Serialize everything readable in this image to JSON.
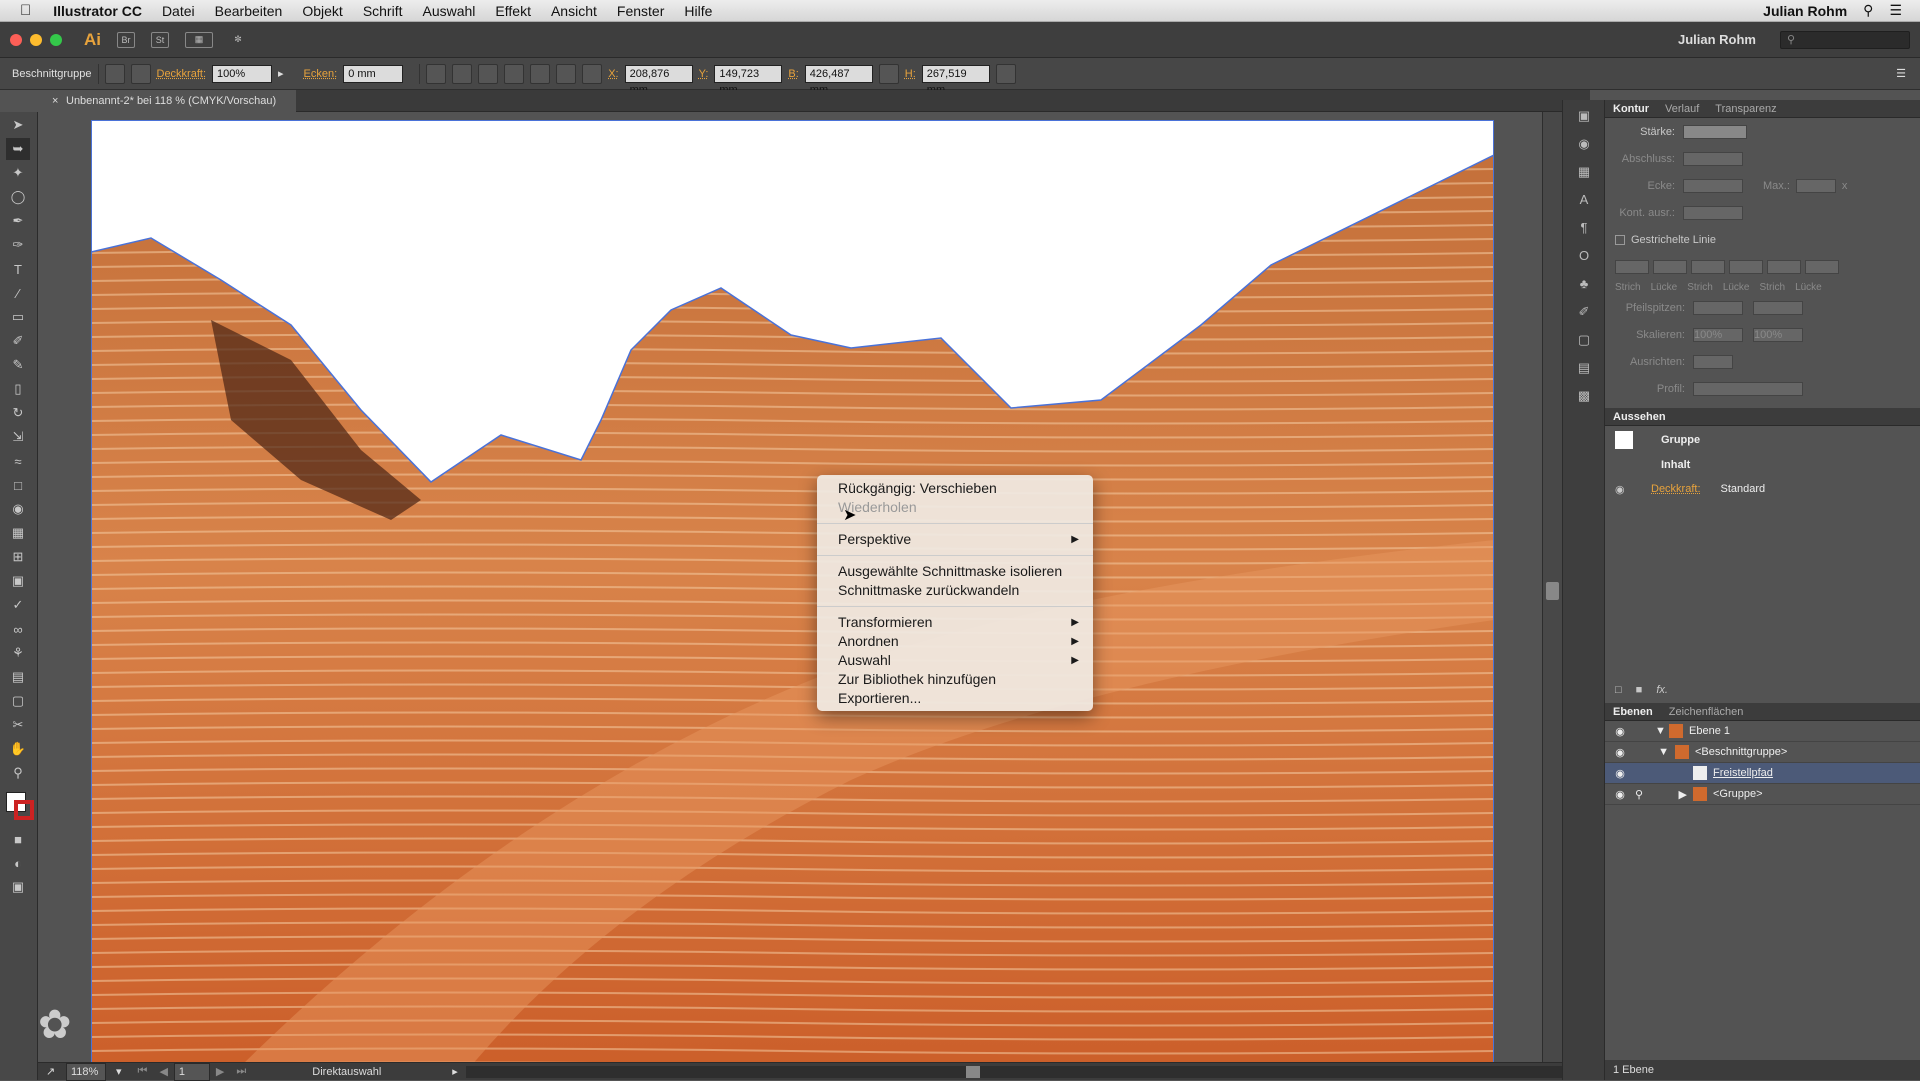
{
  "menubar": {
    "app": "Illustrator CC",
    "items": [
      "Datei",
      "Bearbeiten",
      "Objekt",
      "Schrift",
      "Auswahl",
      "Effekt",
      "Ansicht",
      "Fenster",
      "Hilfe"
    ],
    "user": "Julian Rohm"
  },
  "appbar": {
    "logo": "Ai",
    "br": "Br",
    "st": "St",
    "user": "Julian Rohm"
  },
  "control": {
    "selection": "Beschnittgruppe",
    "opacity_label": "Deckkraft:",
    "opacity_value": "100%",
    "corners_label": "Ecken:",
    "corners_value": "0 mm",
    "x_label": "X:",
    "x_value": "208,876 mm",
    "y_label": "Y:",
    "y_value": "149,723 mm",
    "w_label": "B:",
    "w_value": "426,487 mm",
    "h_label": "H:",
    "h_value": "267,519 mm"
  },
  "document": {
    "tab": "Unbenannt-2* bei 118 % (CMYK/Vorschau)"
  },
  "status": {
    "zoom": "118%",
    "page": "1",
    "tool": "Direktauswahl"
  },
  "context_menu": {
    "items": [
      {
        "label": "Rückgängig: Verschieben"
      },
      {
        "label": "Wiederholen"
      },
      {
        "label": "Perspektive"
      },
      {
        "label": "Ausgewählte Schnittmaske isolieren"
      },
      {
        "label": "Schnittmaske zurückwandeln"
      },
      {
        "label": "Transformieren"
      },
      {
        "label": "Anordnen"
      },
      {
        "label": "Auswahl"
      },
      {
        "label": "Zur Bibliothek hinzufügen"
      },
      {
        "label": "Exportieren..."
      }
    ]
  },
  "stroke_panel": {
    "tabs": [
      "Kontur",
      "Verlauf",
      "Transparenz"
    ],
    "weight": "Stärke:",
    "cap": "Abschluss:",
    "corner": "Ecke:",
    "limit": "Max.:",
    "limit_x": "x",
    "align": "Kont. ausr.:",
    "dashed": "Gestrichelte Linie",
    "dash_labels": [
      "Strich",
      "Lücke",
      "Strich",
      "Lücke",
      "Strich",
      "Lücke"
    ],
    "arrowheads": "Pfeilspitzen:",
    "scale": "Skalieren:",
    "scale_value": "100%",
    "alignment": "Ausrichten:",
    "profile": "Profil:"
  },
  "appearance_panel": {
    "title": "Aussehen",
    "group": "Gruppe",
    "content": "Inhalt",
    "opacity_label": "Deckkraft:",
    "opacity_value": "Standard",
    "fx": "fx."
  },
  "layers_panel": {
    "tabs": [
      "Ebenen",
      "Zeichenflächen"
    ],
    "layers": [
      {
        "name": "Ebene 1"
      },
      {
        "name": "<Beschnittgruppe>"
      },
      {
        "name": "Freistellpfad"
      },
      {
        "name": "<Gruppe>"
      }
    ],
    "footer": "1 Ebene"
  },
  "colors": {
    "accent": "#e8a33c",
    "selection": "#4a72d8",
    "rock": "#cf6a2e"
  }
}
